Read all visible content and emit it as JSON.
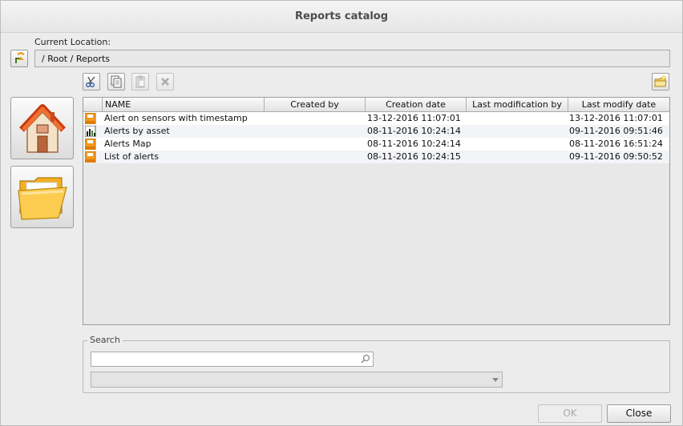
{
  "window": {
    "title": "Reports catalog"
  },
  "location": {
    "label": "Current Location:",
    "path": "/ Root / Reports"
  },
  "toolbar": {
    "cut_icon": "scissors-icon",
    "copy_icon": "copy-icon",
    "paste_icon": "paste-icon",
    "delete_icon": "delete-x-icon",
    "new_folder_icon": "new-folder-icon"
  },
  "sidebar": {
    "home_icon": "home-icon",
    "folder_icon": "folder-icon"
  },
  "table": {
    "headers": [
      "NAME",
      "Created by",
      "Creation date",
      "Last modification by",
      "Last modify date"
    ],
    "rows": [
      {
        "icon": "report-icon",
        "name": "Alert on sensors with timestamp",
        "created_by": "",
        "creation_date": "13-12-2016  11:07:01",
        "modified_by": "",
        "modify_date": "13-12-2016  11:07:01"
      },
      {
        "icon": "chart-report-icon",
        "name": "Alerts by asset",
        "created_by": "",
        "creation_date": "08-11-2016  10:24:14",
        "modified_by": "",
        "modify_date": "09-11-2016  09:51:46"
      },
      {
        "icon": "report-icon",
        "name": "Alerts Map",
        "created_by": "",
        "creation_date": "08-11-2016  10:24:14",
        "modified_by": "",
        "modify_date": "08-11-2016  16:51:24"
      },
      {
        "icon": "report-icon",
        "name": "List of alerts",
        "created_by": "",
        "creation_date": "08-11-2016  10:24:15",
        "modified_by": "",
        "modify_date": "09-11-2016  09:50:52"
      }
    ]
  },
  "search": {
    "label": "Search",
    "value": "",
    "combo_value": ""
  },
  "buttons": {
    "ok": "OK",
    "close": "Close"
  },
  "colors": {
    "accent_orange": "#f29a1e",
    "row_alt": "#f2f4f8"
  }
}
